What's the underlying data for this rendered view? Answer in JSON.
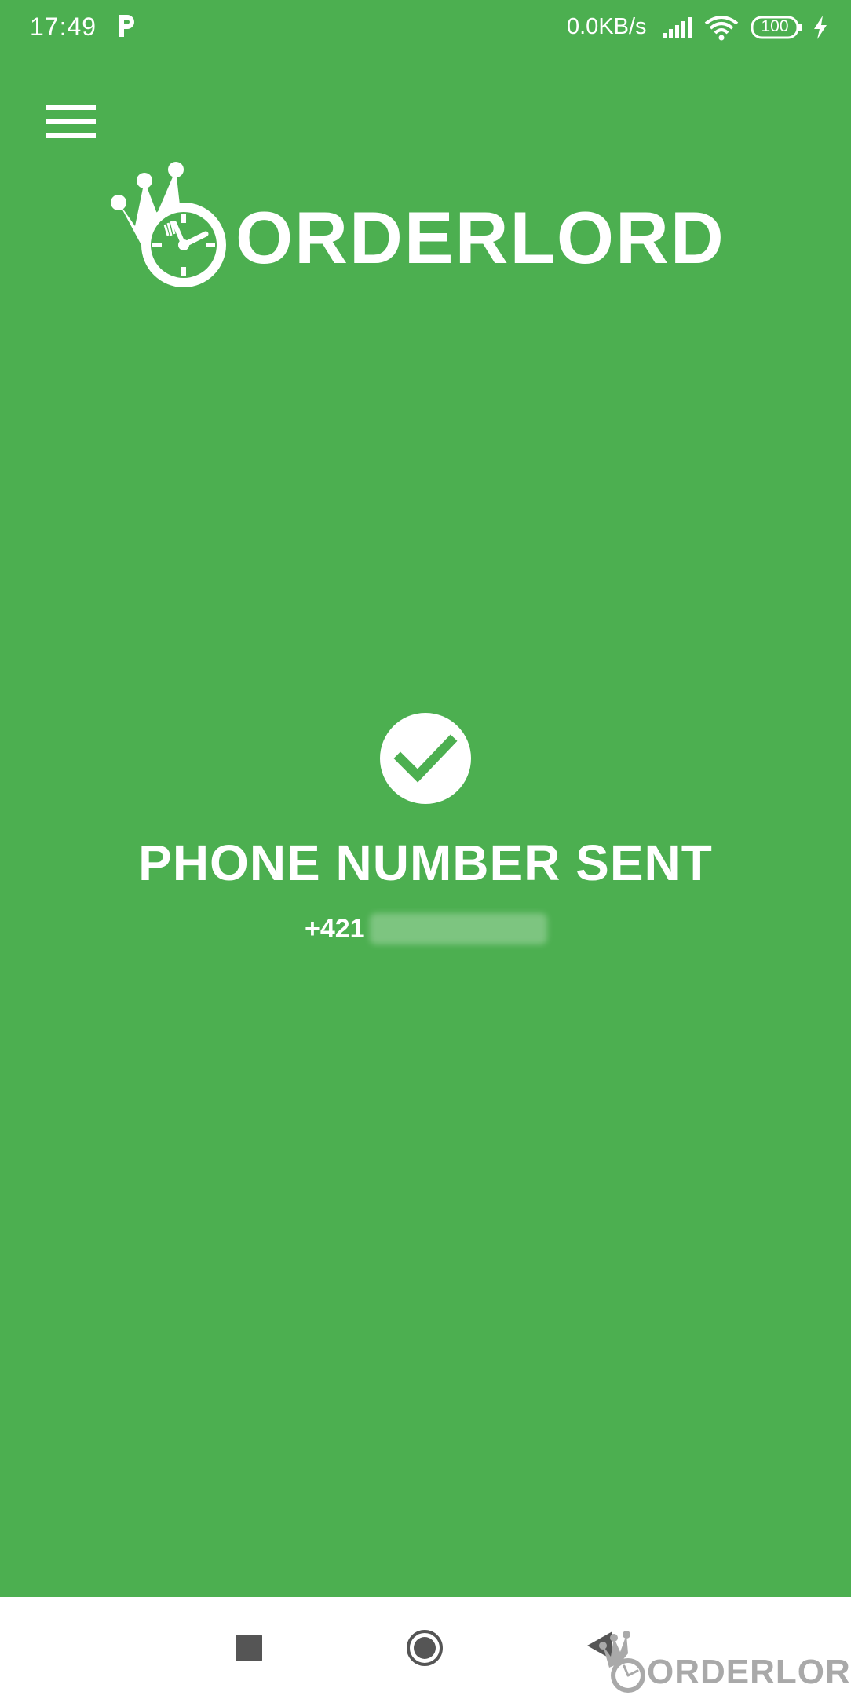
{
  "status_bar": {
    "time": "17:49",
    "network_speed": "0.0KB/s",
    "battery_level": "100",
    "icons": [
      "parking-icon",
      "signal-icon",
      "wifi-icon",
      "battery-icon",
      "charging-icon"
    ]
  },
  "header": {
    "menu_icon": "hamburger-menu-icon",
    "logo_text": "ORDERLORD"
  },
  "confirmation": {
    "icon": "check-circle-icon",
    "title": "PHONE NUMBER SENT",
    "phone_prefix": "+421"
  },
  "nav_bar": {
    "icons": [
      "recent-apps-icon",
      "home-icon",
      "back-icon"
    ]
  },
  "watermark": {
    "text": "ORDERLORD"
  },
  "colors": {
    "background": "#4caf50",
    "foreground": "#ffffff",
    "nav_background": "#ffffff",
    "nav_icon": "#555555",
    "watermark": "#a9a9a9",
    "battery_accent": "#76ff03"
  }
}
